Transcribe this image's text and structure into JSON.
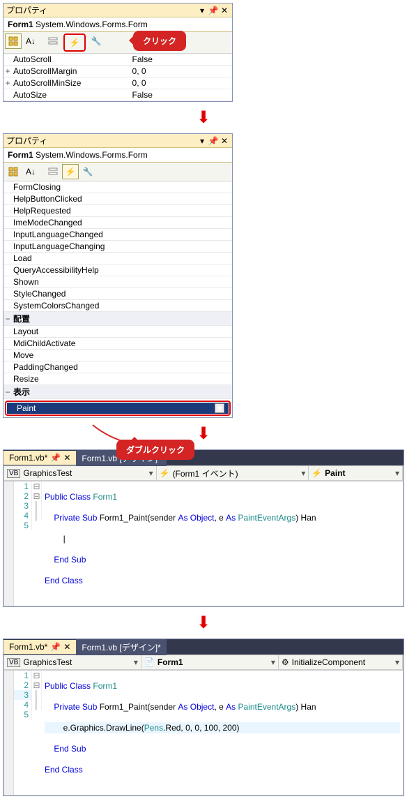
{
  "panel1": {
    "title": "プロパティ",
    "subtitle_name": "Form1",
    "subtitle_type": "System.Windows.Forms.Form",
    "bubble": "クリック",
    "rows": [
      {
        "k": "AutoScroll",
        "v": "False",
        "exp": ""
      },
      {
        "k": "AutoScrollMargin",
        "v": "0, 0",
        "exp": "+"
      },
      {
        "k": "AutoScrollMinSize",
        "v": "0, 0",
        "exp": "+"
      },
      {
        "k": "AutoSize",
        "v": "False",
        "exp": ""
      }
    ]
  },
  "panel2": {
    "title": "プロパティ",
    "subtitle_name": "Form1",
    "subtitle_type": "System.Windows.Forms.Form",
    "bubble": "ダブルクリック",
    "events": [
      "FormClosing",
      "HelpButtonClicked",
      "HelpRequested",
      "ImeModeChanged",
      "InputLanguageChanged",
      "InputLanguageChanging",
      "Load",
      "QueryAccessibilityHelp",
      "Shown",
      "StyleChanged",
      "SystemColorsChanged"
    ],
    "section1": "配置",
    "layout_events": [
      "Layout",
      "MdiChildActivate",
      "Move",
      "PaddingChanged",
      "Resize"
    ],
    "section2": "表示",
    "paint": "Paint"
  },
  "code1": {
    "tab_active": "Form1.vb*",
    "tab_inactive": "Form1.vb [デザイン]*",
    "combo1": "GraphicsTest",
    "combo2": "(Form1 イベント)",
    "combo3": "Paint",
    "lines": {
      "l1": {
        "pre": "",
        "t1": "Public Class ",
        "t2": "Form1"
      },
      "l2": {
        "pre": "    ",
        "t1": "Private Sub ",
        "t2": "Form1_Paint(sender ",
        "t3": "As Object",
        "t4": ", e ",
        "t5": "As ",
        "t6": "PaintEventArgs",
        "t7": ") Han"
      },
      "l3": {
        "pre": "        ",
        "caret": "|"
      },
      "l4": {
        "pre": "    ",
        "t1": "End Sub"
      },
      "l5": {
        "pre": "",
        "t1": "End Class"
      }
    }
  },
  "code2": {
    "tab_active": "Form1.vb*",
    "tab_inactive": "Form1.vb [デザイン]*",
    "combo1": "GraphicsTest",
    "combo2": "Form1",
    "combo3": "InitializeComponent",
    "lines": {
      "l1": {
        "t1": "Public Class ",
        "t2": "Form1"
      },
      "l2": {
        "t1": "    Private Sub ",
        "t2": "Form1_Paint(sender ",
        "t3": "As Object",
        "t4": ", e ",
        "t5": "As ",
        "t6": "PaintEventArgs",
        "t7": ") Han"
      },
      "l3": {
        "t1": "        e.Graphics.DrawLine(",
        "t2": "Pens",
        "t3": ".Red, 0, 0, 100, 200)"
      },
      "l4": {
        "t1": "    End Sub"
      },
      "l5": {
        "t1": "End Class"
      }
    }
  }
}
